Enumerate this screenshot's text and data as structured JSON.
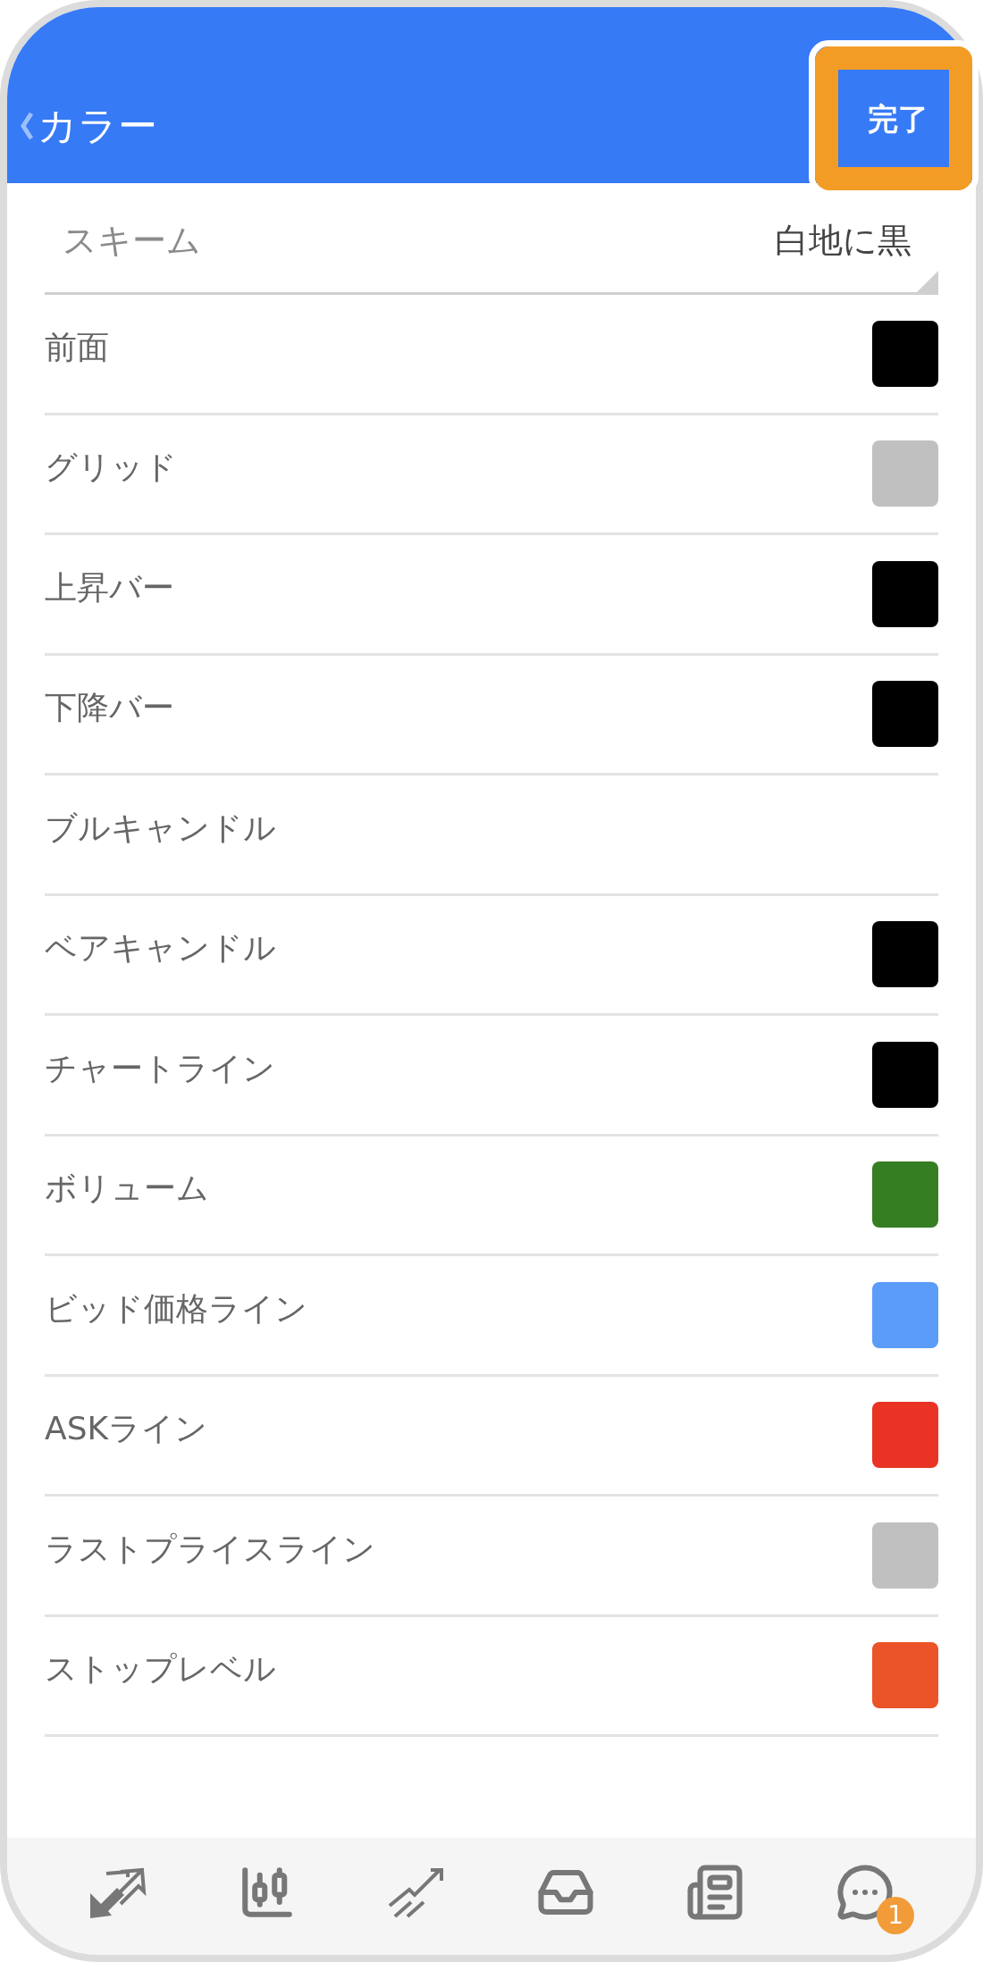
{
  "header": {
    "title": "カラー",
    "done_button": "完了",
    "done_highlighted": true
  },
  "scheme": {
    "label": "スキーム",
    "value": "白地に黒"
  },
  "colors": [
    {
      "label": "前面",
      "color": "#000000"
    },
    {
      "label": "グリッド",
      "color": "#c0c0c0"
    },
    {
      "label": "上昇バー",
      "color": "#000000"
    },
    {
      "label": "下降バー",
      "color": "#000000"
    },
    {
      "label": "ブルキャンドル"
    },
    {
      "label": "ベアキャンドル",
      "color": "#000000"
    },
    {
      "label": "チャートライン",
      "color": "#000000"
    },
    {
      "label": "ボリューム",
      "color": "#367e22"
    },
    {
      "label": "ビッド価格ライン",
      "color": "#5b9cf8"
    },
    {
      "label": "ASKライン",
      "color": "#e93325"
    },
    {
      "label": "ラストプライスライン",
      "color": "#c0c0c0"
    },
    {
      "label": "ストップレベル",
      "color": "#eb5428"
    }
  ],
  "tab_bar": {
    "chat_badge": "1"
  }
}
